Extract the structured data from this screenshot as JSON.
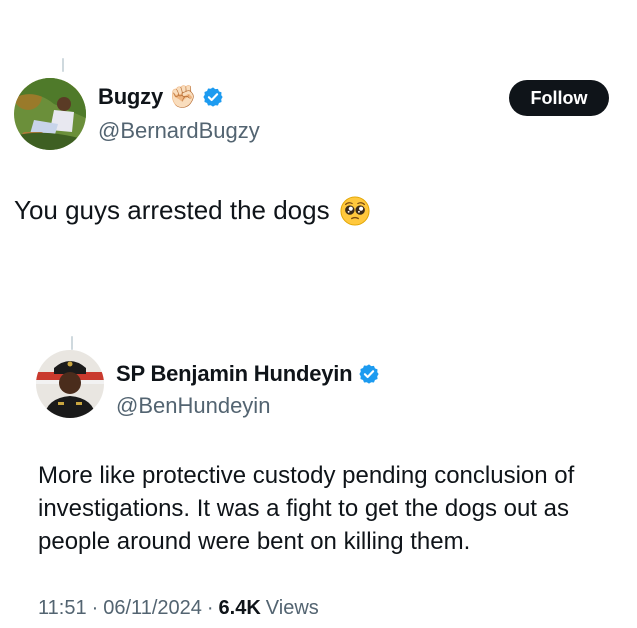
{
  "tweet": {
    "author": {
      "display_name": "Bugzy",
      "name_emoji": "✊🏻",
      "handle": "@BernardBugzy",
      "verified": true
    },
    "follow_label": "Follow",
    "text": "You guys arrested the dogs",
    "text_emoji": "pleading-face"
  },
  "quoted": {
    "author": {
      "display_name": "SP Benjamin Hundeyin",
      "handle": "@BenHundeyin",
      "verified": true
    },
    "text": "More like protective custody pending conclusion of investigations. It was a fight to get the dogs out as people around were bent on killing them."
  },
  "meta": {
    "time": "11:51",
    "separator": "·",
    "date": "06/11/2024",
    "views_count": "6.4K",
    "views_label": "Views"
  },
  "colors": {
    "verified_badge": "#1d9bf0",
    "secondary_text": "#536471",
    "follow_button_bg": "#0f1419"
  }
}
